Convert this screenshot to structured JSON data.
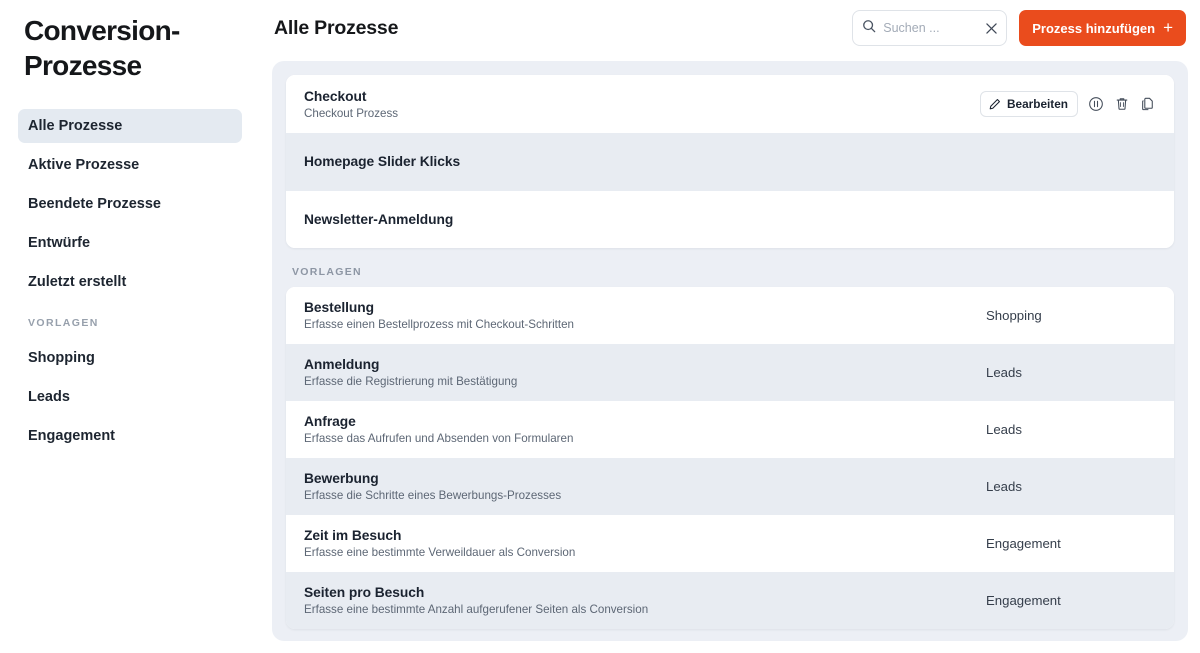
{
  "sidebar": {
    "title": "Conversion-\nProzesse",
    "nav_items": [
      {
        "label": "Alle Prozesse",
        "active": true
      },
      {
        "label": "Aktive Prozesse",
        "active": false
      },
      {
        "label": "Beendete Prozesse",
        "active": false
      },
      {
        "label": "Entwürfe",
        "active": false
      },
      {
        "label": "Zuletzt erstellt",
        "active": false
      }
    ],
    "section_label": "VORLAGEN",
    "section_items": [
      {
        "label": "Shopping"
      },
      {
        "label": "Leads"
      },
      {
        "label": "Engagement"
      }
    ]
  },
  "topbar": {
    "page_title": "Alle Prozesse",
    "search": {
      "icon": "search-icon",
      "value": "",
      "placeholder": "Suchen ...",
      "clear_icon": "close-icon"
    },
    "add_button": {
      "label": "Prozess hinzufügen",
      "icon": "plus-icon",
      "color": "#ea4c1d"
    }
  },
  "processes": [
    {
      "title": "Checkout",
      "subtitle": "Checkout Prozess",
      "alt": false,
      "actions": {
        "edit_label": "Bearbeiten",
        "edit_icon": "pencil-icon",
        "pause_icon": "pause-circle-icon",
        "delete_icon": "trash-icon",
        "duplicate_icon": "copy-icon"
      }
    },
    {
      "title": "Homepage Slider Klicks",
      "subtitle": "",
      "alt": true
    },
    {
      "title": "Newsletter-Anmeldung",
      "subtitle": "",
      "alt": false
    }
  ],
  "templates_section": {
    "label": "VORLAGEN",
    "items": [
      {
        "title": "Bestellung",
        "subtitle": "Erfasse einen Bestellprozess mit Checkout-Schritten",
        "category": "Shopping",
        "alt": false
      },
      {
        "title": "Anmeldung",
        "subtitle": "Erfasse die Registrierung mit Bestätigung",
        "category": "Leads",
        "alt": true
      },
      {
        "title": "Anfrage",
        "subtitle": "Erfasse das Aufrufen und Absenden von Formularen",
        "category": "Leads",
        "alt": false
      },
      {
        "title": "Bewerbung",
        "subtitle": "Erfasse die Schritte eines Bewerbungs-Prozesses",
        "category": "Leads",
        "alt": true
      },
      {
        "title": "Zeit im Besuch",
        "subtitle": "Erfasse eine bestimmte Verweildauer als Conversion",
        "category": "Engagement",
        "alt": false
      },
      {
        "title": "Seiten pro Besuch",
        "subtitle": "Erfasse eine bestimmte Anzahl aufgerufener Seiten als Conversion",
        "category": "Engagement",
        "alt": true
      }
    ]
  },
  "colors": {
    "accent": "#ea4c1d",
    "panel_bg": "#eceff5",
    "row_alt_bg": "#e8ecf2",
    "sidebar_active_bg": "#e4eaf1"
  }
}
